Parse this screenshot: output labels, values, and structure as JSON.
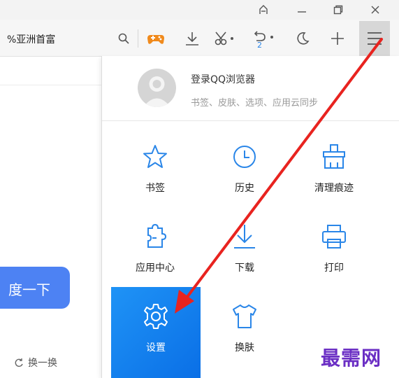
{
  "tab": {
    "title": "%亚洲首富"
  },
  "window": {
    "controls": [
      "pin-icon",
      "minimize-icon",
      "restore-icon",
      "close-icon"
    ]
  },
  "toolbar": {
    "icons": [
      "search-icon",
      "game-icon",
      "download-icon",
      "scissors-icon",
      "undo-icon",
      "moon-icon",
      "plus-icon",
      "menu-icon"
    ],
    "undo_badge": "2"
  },
  "page": {
    "search_button_label": "度一下",
    "refresh_label": "换一换"
  },
  "menu": {
    "login": {
      "title": "登录QQ浏览器",
      "subtitle": "书签、皮肤、选项、应用云同步"
    },
    "items": [
      {
        "label": "书签",
        "icon": "star-icon"
      },
      {
        "label": "历史",
        "icon": "clock-icon"
      },
      {
        "label": "清理痕迹",
        "icon": "broom-icon"
      },
      {
        "label": "应用中心",
        "icon": "puzzle-icon"
      },
      {
        "label": "下载",
        "icon": "download-icon"
      },
      {
        "label": "打印",
        "icon": "printer-icon"
      },
      {
        "label": "设置",
        "icon": "gear-icon",
        "highlighted": true
      },
      {
        "label": "换肤",
        "icon": "tshirt-icon"
      }
    ]
  },
  "watermark": "最需网",
  "colors": {
    "accent": "#2a86e8",
    "highlight": "#0a6fe6",
    "arrow": "#e8231f",
    "search_button": "#4d82f3",
    "watermark": "#6b2fc4"
  }
}
